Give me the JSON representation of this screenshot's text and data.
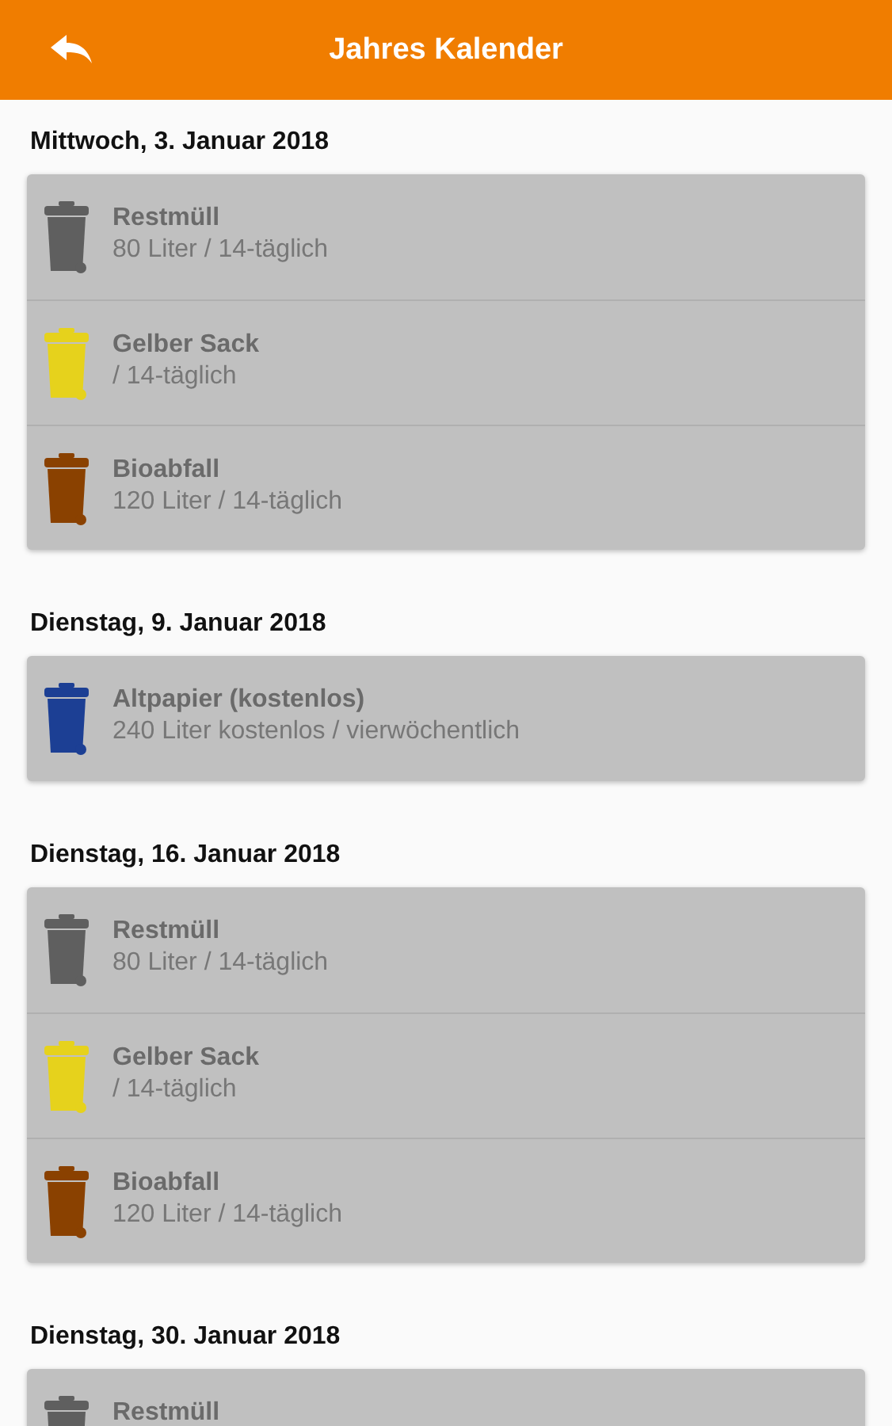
{
  "header": {
    "title": "Jahres Kalender"
  },
  "days": [
    {
      "date": "Mittwoch, 3. Januar 2018",
      "items": [
        {
          "name": "Restmüll",
          "detail": "80 Liter / 14-täglich",
          "color": "#5f5f5f"
        },
        {
          "name": "Gelber Sack",
          "detail": "/ 14-täglich",
          "color": "#e6d21c"
        },
        {
          "name": "Bioabfall",
          "detail": "120 Liter / 14-täglich",
          "color": "#8a4100"
        }
      ]
    },
    {
      "date": "Dienstag, 9. Januar 2018",
      "items": [
        {
          "name": "Altpapier (kostenlos)",
          "detail": "240 Liter kostenlos / vierwöchentlich",
          "color": "#1c3f94"
        }
      ]
    },
    {
      "date": "Dienstag, 16. Januar 2018",
      "items": [
        {
          "name": "Restmüll",
          "detail": "80 Liter / 14-täglich",
          "color": "#5f5f5f"
        },
        {
          "name": "Gelber Sack",
          "detail": "/ 14-täglich",
          "color": "#e6d21c"
        },
        {
          "name": "Bioabfall",
          "detail": "120 Liter / 14-täglich",
          "color": "#8a4100"
        }
      ]
    },
    {
      "date": "Dienstag, 30. Januar 2018",
      "items": [
        {
          "name": "Restmüll",
          "color": "#5f5f5f"
        }
      ]
    }
  ]
}
